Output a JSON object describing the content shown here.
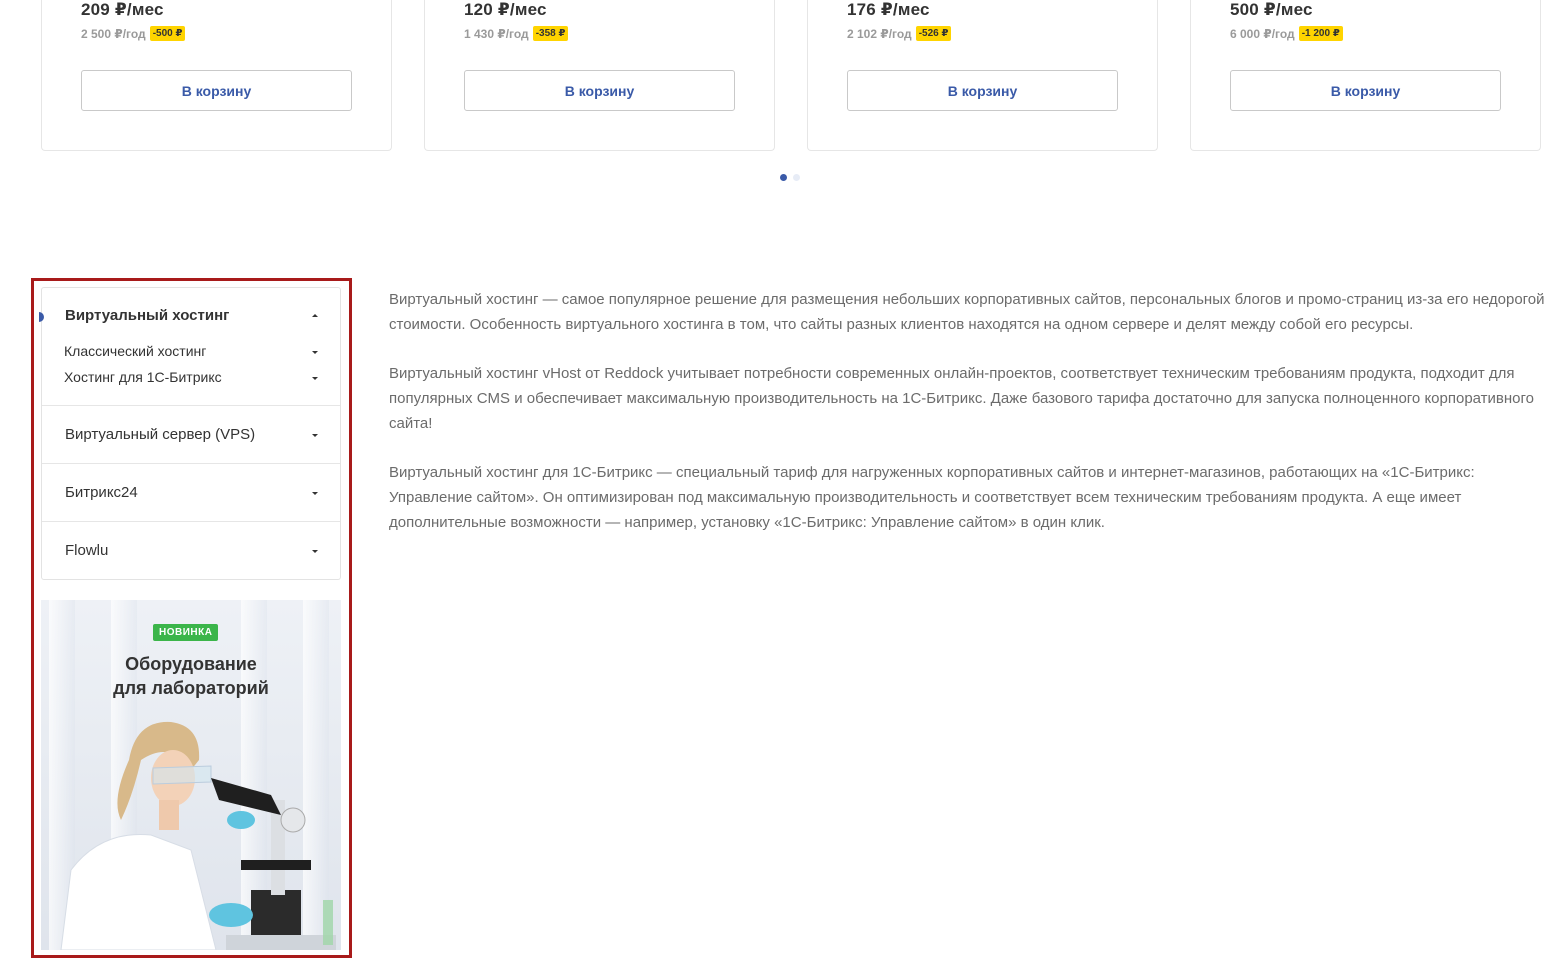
{
  "cards": [
    {
      "price": "209 ₽/мес",
      "yearly": "2 500 ₽/год",
      "discount": "-500 ₽",
      "button": "В корзину"
    },
    {
      "price": "120 ₽/мес",
      "yearly": "1 430 ₽/год",
      "discount": "-358 ₽",
      "button": "В корзину"
    },
    {
      "price": "176 ₽/мес",
      "yearly": "2 102 ₽/год",
      "discount": "-526 ₽",
      "button": "В корзину"
    },
    {
      "price": "500 ₽/мес",
      "yearly": "6 000 ₽/год",
      "discount": "-1 200 ₽",
      "button": "В корзину"
    }
  ],
  "carousel": {
    "pages": 2,
    "active": 1
  },
  "sidebar": {
    "sections": [
      {
        "label": "Виртуальный хостинг",
        "expanded": true,
        "items": [
          {
            "label": "Классический хостинг"
          },
          {
            "label": "Хостинг для 1С-Битрикс"
          }
        ]
      },
      {
        "label": "Виртуальный сервер (VPS)",
        "expanded": false
      },
      {
        "label": "Битрикс24",
        "expanded": false
      },
      {
        "label": "Flowlu",
        "expanded": false
      }
    ]
  },
  "promo": {
    "badge": "НОВИНКА",
    "title_line1": "Оборудование",
    "title_line2": "для лабораторий"
  },
  "description": {
    "paragraphs": [
      "Виртуальный хостинг — самое популярное решение для размещения небольших корпоративных сайтов, персональных блогов и промо-страниц из-за его недорогой стоимости. Особенность виртуального хостинга в том, что сайты разных клиентов находятся на одном сервере и делят между собой его ресурсы.",
      "Виртуальный хостинг vHost от Reddock учитывает потребности современных онлайн-проектов, соответствует техническим требованиям продукта, подходит для популярных CMS и обеспечивает максимальную производительность на 1С-Битрикс. Даже базового тарифа достаточно для запуска полноценного корпоративного сайта!",
      "Виртуальный хостинг для 1С-Битрикс — специальный тариф для нагруженных корпоративных сайтов и интернет-магазинов, работающих на «1С-Битрикс: Управление сайтом». Он оптимизирован под максимальную производительность и соответствует всем техническим требованиям продукта. А еще имеет дополнительные возможности — например, установку «1С-Битрикс: Управление сайтом» в один клик."
    ]
  },
  "colors": {
    "accent": "#3a5aa8",
    "badge_yellow": "#ffd400",
    "badge_green": "#3bb54a",
    "highlight_frame": "#a81a1a"
  }
}
